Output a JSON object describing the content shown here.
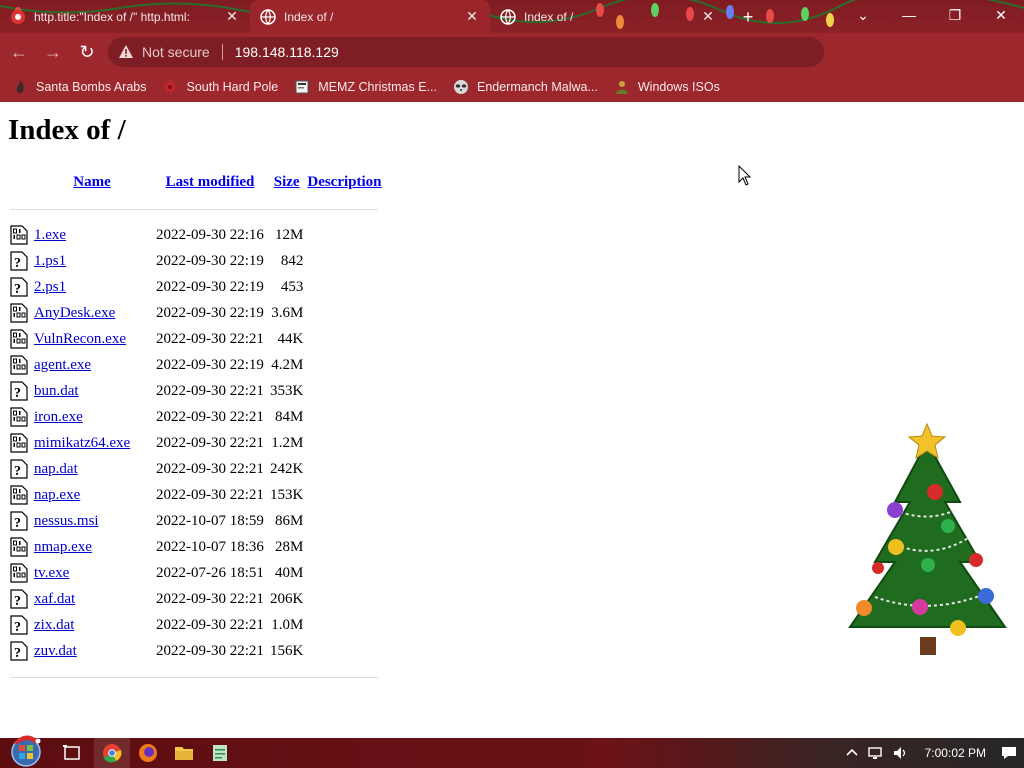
{
  "browser": {
    "tabs": [
      {
        "title": "http.title:\"Index of /\" http.html:",
        "active": false
      },
      {
        "title": "Index of /",
        "active": true
      },
      {
        "title": "Index of /",
        "active": false
      }
    ],
    "address": {
      "security_label": "Not secure",
      "url": "198.148.118.129"
    },
    "bookmarks": [
      {
        "label": "Santa Bombs Arabs",
        "icon": "flame-icon"
      },
      {
        "label": "South Hard Pole",
        "icon": "virus-icon"
      },
      {
        "label": "MEMZ Christmas E...",
        "icon": "page-icon"
      },
      {
        "label": "Endermanch Malwa...",
        "icon": "raccoon-icon"
      },
      {
        "label": "Windows ISOs",
        "icon": "person-icon"
      }
    ],
    "accent_color": "#9c272d"
  },
  "page": {
    "title": "Index of /",
    "columns": {
      "name": "Name",
      "modified": "Last modified",
      "size": "Size",
      "description": "Description"
    },
    "files": [
      {
        "name": "1.exe",
        "modified": "2022-09-30 22:16",
        "size": "12M",
        "icon": "binary-icon"
      },
      {
        "name": "1.ps1",
        "modified": "2022-09-30 22:19",
        "size": "842",
        "icon": "unknown-icon"
      },
      {
        "name": "2.ps1",
        "modified": "2022-09-30 22:19",
        "size": "453",
        "icon": "unknown-icon"
      },
      {
        "name": "AnyDesk.exe",
        "modified": "2022-09-30 22:19",
        "size": "3.6M",
        "icon": "binary-icon"
      },
      {
        "name": "VulnRecon.exe",
        "modified": "2022-09-30 22:21",
        "size": "44K",
        "icon": "binary-icon"
      },
      {
        "name": "agent.exe",
        "modified": "2022-09-30 22:19",
        "size": "4.2M",
        "icon": "binary-icon"
      },
      {
        "name": "bun.dat",
        "modified": "2022-09-30 22:21",
        "size": "353K",
        "icon": "unknown-icon"
      },
      {
        "name": "iron.exe",
        "modified": "2022-09-30 22:21",
        "size": "84M",
        "icon": "binary-icon"
      },
      {
        "name": "mimikatz64.exe",
        "modified": "2022-09-30 22:21",
        "size": "1.2M",
        "icon": "binary-icon"
      },
      {
        "name": "nap.dat",
        "modified": "2022-09-30 22:21",
        "size": "242K",
        "icon": "unknown-icon"
      },
      {
        "name": "nap.exe",
        "modified": "2022-09-30 22:21",
        "size": "153K",
        "icon": "binary-icon"
      },
      {
        "name": "nessus.msi",
        "modified": "2022-10-07 18:59",
        "size": "86M",
        "icon": "unknown-icon"
      },
      {
        "name": "nmap.exe",
        "modified": "2022-10-07 18:36",
        "size": "28M",
        "icon": "binary-icon"
      },
      {
        "name": "tv.exe",
        "modified": "2022-07-26 18:51",
        "size": "40M",
        "icon": "binary-icon"
      },
      {
        "name": "xaf.dat",
        "modified": "2022-09-30 22:21",
        "size": "206K",
        "icon": "unknown-icon"
      },
      {
        "name": "zix.dat",
        "modified": "2022-09-30 22:21",
        "size": "1.0M",
        "icon": "unknown-icon"
      },
      {
        "name": "zuv.dat",
        "modified": "2022-09-30 22:21",
        "size": "156K",
        "icon": "unknown-icon"
      }
    ],
    "link_color": "#0000cc"
  },
  "taskbar": {
    "clock": "7:00:02 PM",
    "apps": [
      "task-view-icon",
      "chrome-icon",
      "firefox-icon",
      "folder-icon",
      "notepad-icon"
    ]
  }
}
